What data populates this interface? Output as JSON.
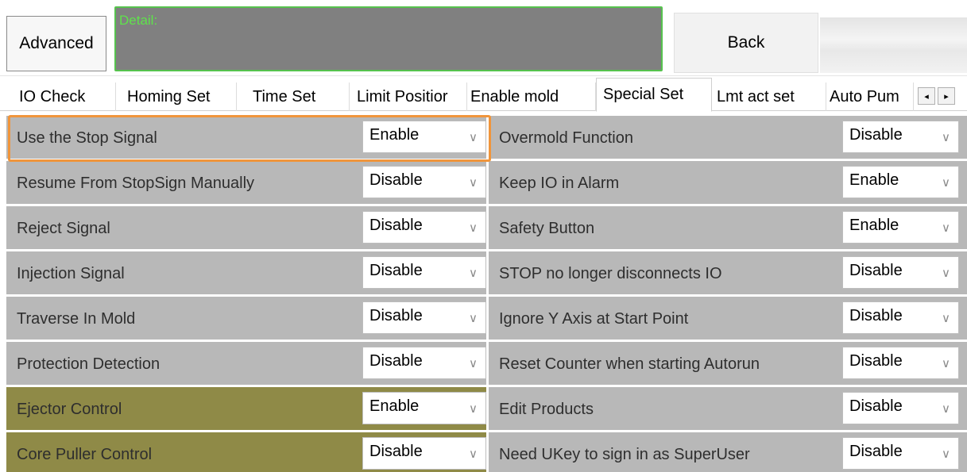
{
  "toolbar": {
    "advanced_label": "Advanced",
    "detail_text": "Detail:",
    "back_label": "Back"
  },
  "tabs": [
    {
      "label": "IO Check",
      "active": false
    },
    {
      "label": "Homing Set",
      "active": false
    },
    {
      "label": "Time Set",
      "active": false
    },
    {
      "label": "Limit Positior",
      "active": false
    },
    {
      "label": "Enable mold",
      "active": false
    },
    {
      "label": "Special Set",
      "active": true
    },
    {
      "label": "Lmt act set",
      "active": false
    },
    {
      "label": "Auto Pum",
      "active": false
    }
  ],
  "tab_scroll": {
    "left": "◂",
    "right": "▸"
  },
  "settings": {
    "left": [
      {
        "label": "Use the Stop Signal",
        "value": "Enable",
        "highlighted": true
      },
      {
        "label": "Resume From StopSign Manually",
        "value": "Disable"
      },
      {
        "label": "Reject Signal",
        "value": "Disable"
      },
      {
        "label": "Injection Signal",
        "value": "Disable"
      },
      {
        "label": "Traverse In Mold",
        "value": "Disable"
      },
      {
        "label": "Protection Detection",
        "value": "Disable"
      },
      {
        "label": "Ejector Control",
        "value": "Enable",
        "style": "olive"
      },
      {
        "label": "Core Puller Control",
        "value": "Disable",
        "style": "olive"
      }
    ],
    "right": [
      {
        "label": "Overmold Function",
        "value": "Disable"
      },
      {
        "label": "Keep IO in Alarm",
        "value": "Enable"
      },
      {
        "label": "Safety Button",
        "value": "Enable"
      },
      {
        "label": "STOP no longer disconnects IO",
        "value": "Disable"
      },
      {
        "label": "Ignore Y Axis at Start Point",
        "value": "Disable"
      },
      {
        "label": "Reset Counter when starting Autorun",
        "value": "Disable"
      },
      {
        "label": "Edit Products",
        "value": "Disable"
      },
      {
        "label": "Need UKey to sign in as SuperUser",
        "value": "Disable"
      }
    ],
    "chevron": "∨"
  },
  "colors": {
    "row_gray": "#b8b8b8",
    "row_olive": "#8f8a47",
    "highlight": "#f0953b",
    "detail_bg": "#808080",
    "detail_text": "#5fe24b"
  }
}
